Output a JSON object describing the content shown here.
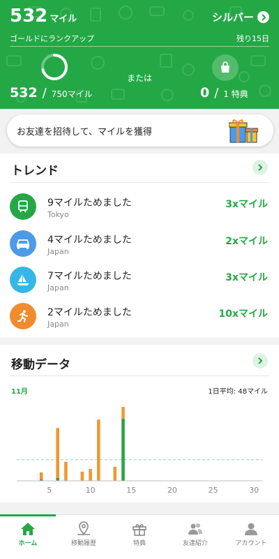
{
  "colors": {
    "brand_green": "#24a845",
    "train": "#24a845",
    "car": "#4c9be8",
    "boat": "#36b6e6",
    "run": "#f08c2e",
    "bar_orange": "#f0962e",
    "bar_green": "#24a845"
  },
  "header": {
    "miles": "532",
    "miles_unit": "マイル",
    "rank_label": "シルバー",
    "upgrade_text": "ゴールドにランクアップ",
    "days_left": "残り15日",
    "or_text": "または",
    "progress_current": "532",
    "progress_slash": "/",
    "progress_goal": "750マイル",
    "benefit_current": "0",
    "benefit_slash": "/",
    "benefit_goal": "1 特典",
    "progress_fraction": 0.709
  },
  "invite": {
    "text": "お友達を招待して、マイルを獲得",
    "icon": "gift-icon"
  },
  "trend": {
    "title": "トレンド",
    "items": [
      {
        "title": "9マイルためました",
        "place": "Tokyo",
        "multiplier": "3xマイル",
        "icon": "train-icon"
      },
      {
        "title": "4マイルためました",
        "place": "Japan",
        "multiplier": "2xマイル",
        "icon": "car-icon"
      },
      {
        "title": "7マイルためました",
        "place": "Japan",
        "multiplier": "3xマイル",
        "icon": "boat-icon"
      },
      {
        "title": "2マイルためました",
        "place": "Japan",
        "multiplier": "10xマイル",
        "icon": "run-icon"
      }
    ]
  },
  "movement": {
    "title": "移動データ",
    "month": "11月",
    "daily_avg": "1日平均: 48マイル"
  },
  "chart_data": {
    "type": "bar",
    "x_ticks": [
      "5",
      "10",
      "15",
      "20",
      "25",
      "30"
    ],
    "xlim": [
      1,
      31
    ],
    "ylim": [
      0,
      110
    ],
    "average_line": 30,
    "series": [
      {
        "values": [
          {
            "day": 4,
            "value": 12
          },
          {
            "day": 6,
            "value": 75
          },
          {
            "day": 7,
            "value": 27
          },
          {
            "day": 9,
            "value": 13
          },
          {
            "day": 10,
            "value": 17
          },
          {
            "day": 11,
            "value": 87
          },
          {
            "day": 13,
            "value": 20
          },
          {
            "day": 14,
            "value": 105
          }
        ]
      }
    ],
    "green_values": [
      {
        "day": 4,
        "value": 2
      },
      {
        "day": 6,
        "value": 4
      },
      {
        "day": 14,
        "value": 88
      }
    ]
  },
  "tabs": [
    {
      "label": "ホーム",
      "icon": "home-icon",
      "active": true
    },
    {
      "label": "移動履歴",
      "icon": "map-pin-icon",
      "active": false
    },
    {
      "label": "特典",
      "icon": "gift-icon",
      "active": false
    },
    {
      "label": "友達紹介",
      "icon": "friends-icon",
      "active": false
    },
    {
      "label": "アカウント",
      "icon": "account-icon",
      "active": false
    }
  ]
}
